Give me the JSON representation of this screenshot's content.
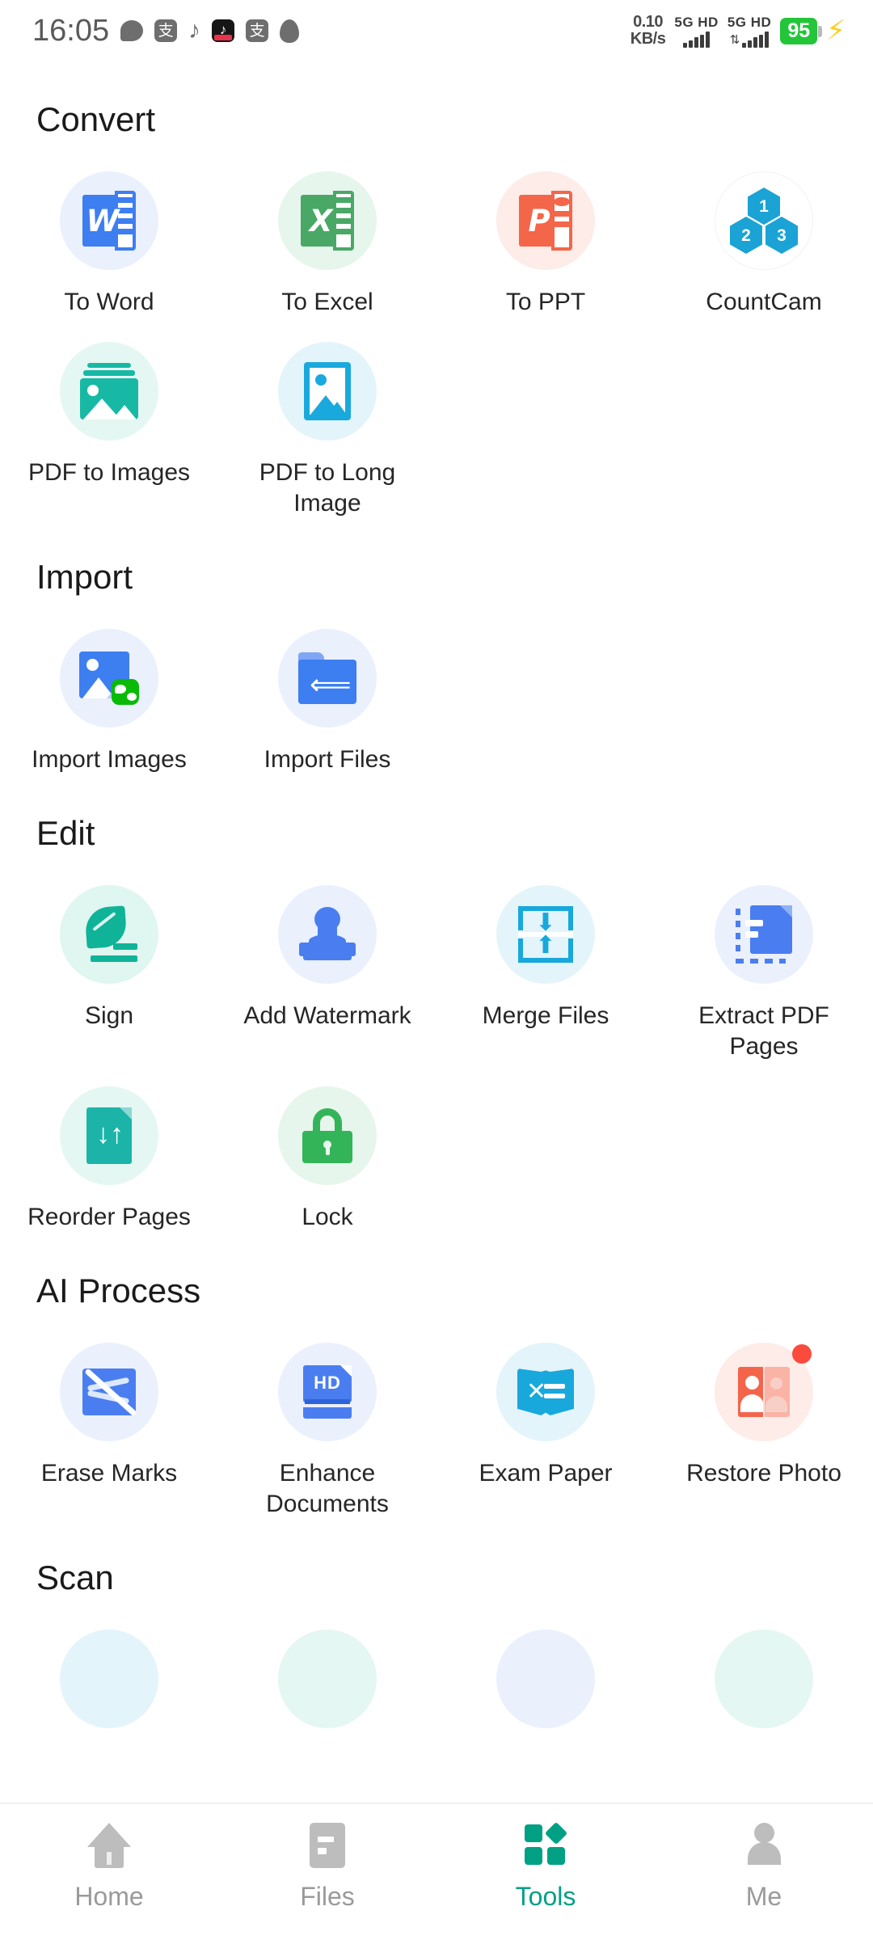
{
  "status_bar": {
    "time": "16:05",
    "app_icons": [
      "chat-bubble-icon",
      "alipay-icon",
      "music-note-icon",
      "tiktok-icon",
      "alipay-icon-2",
      "qq-icon"
    ],
    "alipay_glyph": "支",
    "tiktok_glyph": "♪",
    "network_speed_value": "0.10",
    "network_speed_unit": "KB/s",
    "sim1_label": "5G HD",
    "sim2_label": "5G HD",
    "battery_percent": "95",
    "charging_glyph": "⚡"
  },
  "sections": [
    {
      "title": "Convert",
      "items": [
        {
          "label": "To Word",
          "icon": "word-icon",
          "circle_bg": "#EBF0FD",
          "accent": "#3d7ef0"
        },
        {
          "label": "To Excel",
          "icon": "excel-icon",
          "circle_bg": "#E6F6EC",
          "accent": "#4aa867"
        },
        {
          "label": "To PPT",
          "icon": "powerpoint-icon",
          "circle_bg": "#FDECE8",
          "accent": "#f4664a"
        },
        {
          "label": "CountCam",
          "icon": "countcam-hex-icon",
          "circle_bg": "#FFFFFF",
          "accent": "#1aa3d4"
        },
        {
          "label": "PDF to Images",
          "icon": "photo-stack-icon",
          "circle_bg": "#E4F7F3",
          "accent": "#17b9a5"
        },
        {
          "label": "PDF to Long Image",
          "icon": "tall-photo-icon",
          "circle_bg": "#E4F4FB",
          "accent": "#1aa9dd"
        }
      ]
    },
    {
      "title": "Import",
      "items": [
        {
          "label": "Import Images",
          "icon": "image-wechat-icon",
          "circle_bg": "#EBF0FD",
          "accent": "#3d7ef0"
        },
        {
          "label": "Import Files",
          "icon": "folder-back-icon",
          "circle_bg": "#EBF0FD",
          "accent": "#3d7ef0"
        }
      ]
    },
    {
      "title": "Edit",
      "items": [
        {
          "label": "Sign",
          "icon": "feather-pen-icon",
          "circle_bg": "#E0F6F0",
          "accent": "#0fb398"
        },
        {
          "label": "Add Watermark",
          "icon": "stamp-icon",
          "circle_bg": "#EBF0FD",
          "accent": "#4a7ef0"
        },
        {
          "label": "Merge Files",
          "icon": "merge-arrows-icon",
          "circle_bg": "#E4F4FB",
          "accent": "#18a8dc"
        },
        {
          "label": "Extract PDF Pages",
          "icon": "extract-doc-icon",
          "circle_bg": "#EBF0FD",
          "accent": "#4a7ef0"
        },
        {
          "label": "Reorder Pages",
          "icon": "reorder-doc-icon",
          "circle_bg": "#E4F7F3",
          "accent": "#1cb4a8"
        },
        {
          "label": "Lock",
          "icon": "padlock-icon",
          "circle_bg": "#E7F6EC",
          "accent": "#34b459"
        }
      ]
    },
    {
      "title": "AI Process",
      "items": [
        {
          "label": "Erase Marks",
          "icon": "erase-marks-icon",
          "circle_bg": "#EBF0FD",
          "accent": "#4a7ef0"
        },
        {
          "label": "Enhance Documents",
          "icon": "hd-document-icon",
          "circle_bg": "#EBF0FD",
          "accent": "#4a7ef0"
        },
        {
          "label": "Exam Paper",
          "icon": "exam-book-icon",
          "circle_bg": "#E4F4FB",
          "accent": "#18a8dc"
        },
        {
          "label": "Restore Photo",
          "icon": "restore-photo-icon",
          "circle_bg": "#FDECE8",
          "accent": "#f4644a",
          "badge": true
        }
      ]
    },
    {
      "title": "Scan",
      "items": [
        {
          "label": "",
          "icon": "scan-item-1-icon",
          "circle_bg": "#E4F4FB",
          "accent": "#18a8dc"
        },
        {
          "label": "",
          "icon": "scan-item-2-icon",
          "circle_bg": "#E4F7F3",
          "accent": "#17b9a5"
        },
        {
          "label": "",
          "icon": "scan-item-3-icon",
          "circle_bg": "#EBF0FD",
          "accent": "#4a7ef0"
        },
        {
          "label": "",
          "icon": "scan-item-4-icon",
          "circle_bg": "#E4F7F3",
          "accent": "#17b9a5"
        }
      ]
    }
  ],
  "bottom_nav": {
    "active": "Tools",
    "active_color": "#00a085",
    "inactive_color": "#9a9a9a",
    "items": [
      {
        "label": "Home",
        "icon": "home-icon"
      },
      {
        "label": "Files",
        "icon": "files-icon"
      },
      {
        "label": "Tools",
        "icon": "tools-grid-icon"
      },
      {
        "label": "Me",
        "icon": "person-icon"
      }
    ]
  }
}
